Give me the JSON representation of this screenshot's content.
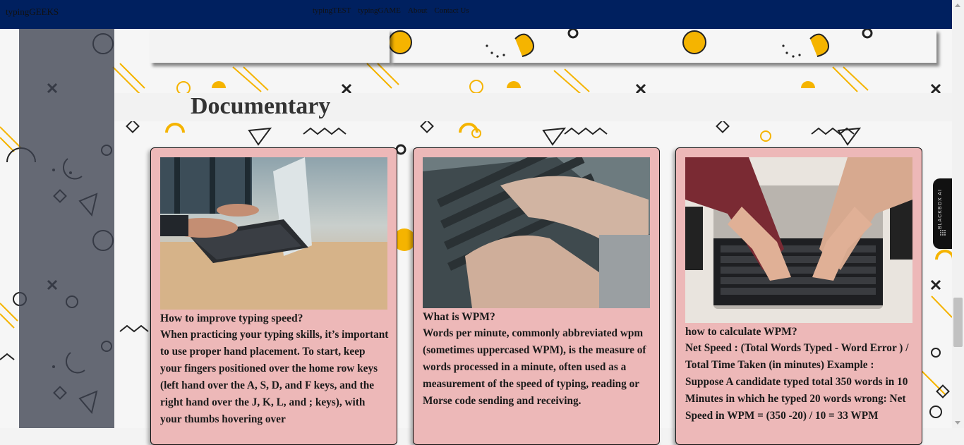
{
  "navbar": {
    "brand": "typingGEEKS",
    "links": [
      "typingTEST",
      "typingGAME",
      "About",
      "Contact Us"
    ]
  },
  "section": {
    "title": "Documentary"
  },
  "cards": [
    {
      "image": "laptop-typing-photo",
      "title": "How to improve typing speed?",
      "body": "When practicing your typing skills, it’s important to use proper hand placement. To start, keep your fingers positioned over the home row keys (left hand over the A, S, D, and F keys, and the right hand over the J, K, L, and ; keys), with your thumbs hovering over"
    },
    {
      "image": "hands-on-keyboard-photo",
      "title": "What is WPM?",
      "body": "Words per minute, commonly abbreviated wpm (sometimes uppercased WPM), is the measure of words processed in a minute, often used as a measurement of the speed of typing, reading or Morse code sending and receiving."
    },
    {
      "image": "laptop-overhead-photo",
      "title": "how to calculate WPM?",
      "body": "Net Speed : (Total Words Typed - Word Error ) / Total Time Taken (in minutes) Example : Suppose A candidate typed total 350 words in 10 Minutes in which he typed 20 words wrong: Net Speed in WPM = (350 -20) / 10 = 33 WPM"
    }
  ],
  "extension_tab": {
    "label": "BLACKBOX AI"
  },
  "colors": {
    "navbar": "#00205f",
    "card": "#edb8b8",
    "accent": "#f5b400",
    "sidebar": "#4b5060"
  }
}
